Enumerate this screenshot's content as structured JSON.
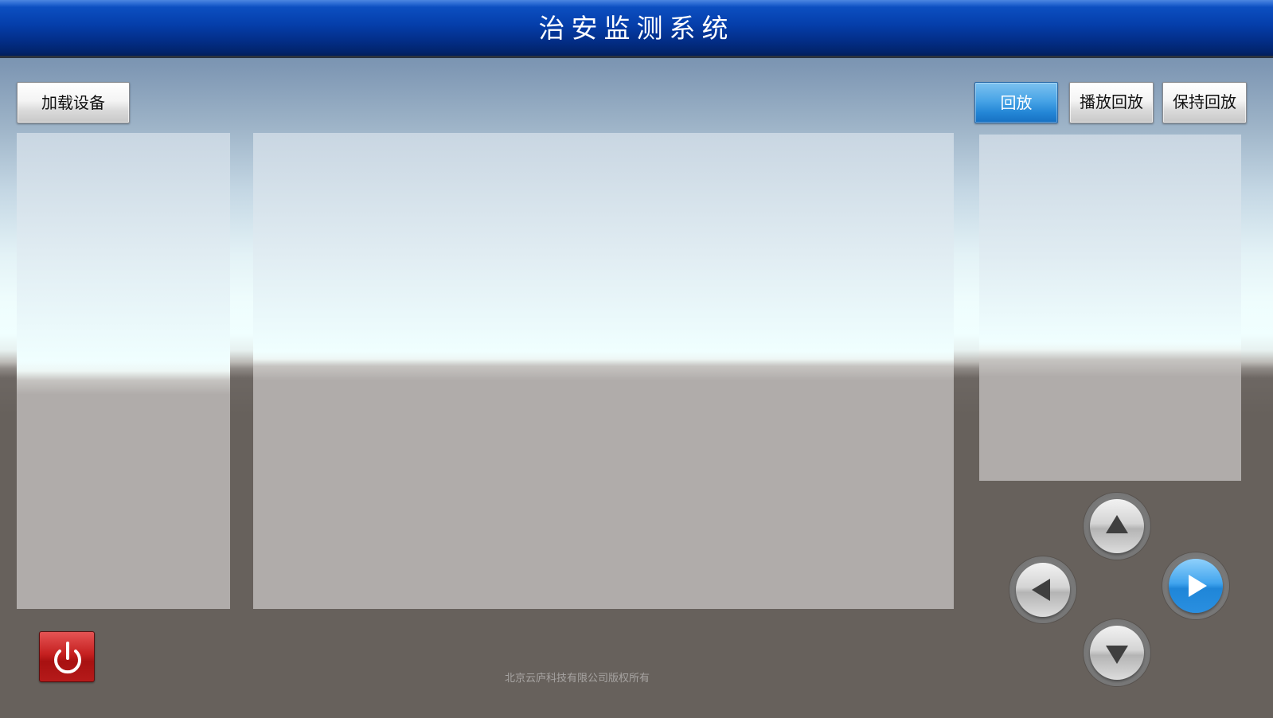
{
  "header": {
    "title": "治安监测系统"
  },
  "toolbar": {
    "load_devices_label": "加载设备",
    "playback_label": "回放",
    "play_playback_label": "播放回放",
    "hold_playback_label": "保持回放"
  },
  "dpad": {
    "up_icon": "triangle-up-icon",
    "down_icon": "triangle-down-icon",
    "left_icon": "triangle-left-icon",
    "right_icon": "triangle-right-icon",
    "active_direction": "right"
  },
  "power": {
    "icon": "power-icon",
    "color": "#c52020"
  },
  "footer": {
    "copyright": "北京云庐科技有限公司版权所有"
  },
  "colors": {
    "title_bar": "#053fac",
    "active_button": "#2386d6",
    "background_bottom": "#67615c"
  }
}
